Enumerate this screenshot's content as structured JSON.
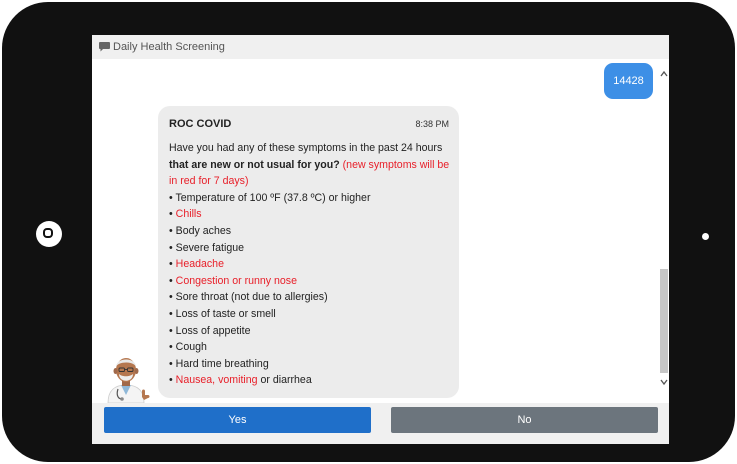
{
  "header": {
    "title": "Daily Health Screening",
    "icon": "chat-bubble-icon"
  },
  "user_message": {
    "text": "14428"
  },
  "bot_message": {
    "sender": "ROC COVID",
    "time": "8:38 PM",
    "intro_plain": "Have you had any of these symptoms in the past 24 hours ",
    "intro_bold": "that are new or not usual for you?",
    "intro_red": " (new symptoms will be in red for 7 days)",
    "symptoms": [
      {
        "text": "Temperature of 100 ºF (37.8 ºC) or higher",
        "is_new": false
      },
      {
        "text": "Chills",
        "is_new": true
      },
      {
        "text": "Body aches",
        "is_new": false
      },
      {
        "text": "Severe fatigue",
        "is_new": false
      },
      {
        "text": "Headache",
        "is_new": true
      },
      {
        "text": "Congestion or runny nose",
        "is_new": true
      },
      {
        "text": "Sore throat (not due to allergies)",
        "is_new": false
      },
      {
        "text": "Loss of taste or smell",
        "is_new": false
      },
      {
        "text": "Loss of appetite",
        "is_new": false
      },
      {
        "text": "Cough",
        "is_new": false
      },
      {
        "text": "Hard time breathing",
        "is_new": false
      }
    ],
    "last_symptom_red": "Nausea, vomiting",
    "last_symptom_plain": " or diarrhea",
    "bullet": "•"
  },
  "buttons": {
    "yes": "Yes",
    "no": "No"
  },
  "colors": {
    "user_bubble": "#3d8fe6",
    "bot_bubble": "#ececec",
    "new_symptom": "#e8202a",
    "yes_button": "#1f6fc9",
    "no_button": "#6c757d"
  }
}
